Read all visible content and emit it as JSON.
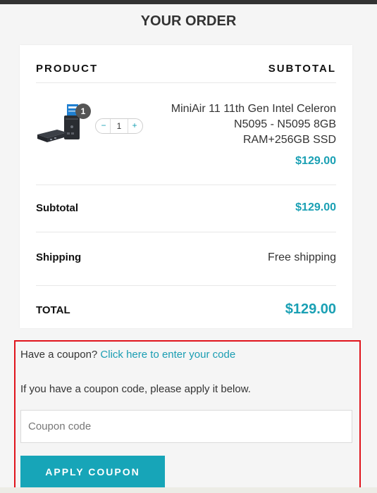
{
  "page": {
    "title": "YOUR ORDER"
  },
  "table": {
    "col_product": "PRODUCT",
    "col_subtotal": "SUBTOTAL"
  },
  "item": {
    "name": "MiniAir 11 11th Gen Intel Celeron N5095 - N5095 8GB RAM+256GB SSD",
    "quantity": "1",
    "badge_count": "1",
    "price": "$129.00",
    "minus_label": "−",
    "plus_label": "+",
    "thumb_icon": "mini-pc-product-image"
  },
  "totals": {
    "subtotal_label": "Subtotal",
    "subtotal_value": "$129.00",
    "shipping_label": "Shipping",
    "shipping_value": "Free shipping",
    "total_label": "TOTAL",
    "total_value": "$129.00"
  },
  "coupon": {
    "prompt": "Have a coupon?",
    "link": "Click here to enter your code",
    "help": "If you have a coupon code, please apply it below.",
    "placeholder": "Coupon code",
    "value": "",
    "apply_label": "APPLY COUPON"
  },
  "colors": {
    "accent": "#1aa0b4",
    "button": "#17a5b8",
    "highlight_border": "#e0141c",
    "topbar": "#333333"
  }
}
